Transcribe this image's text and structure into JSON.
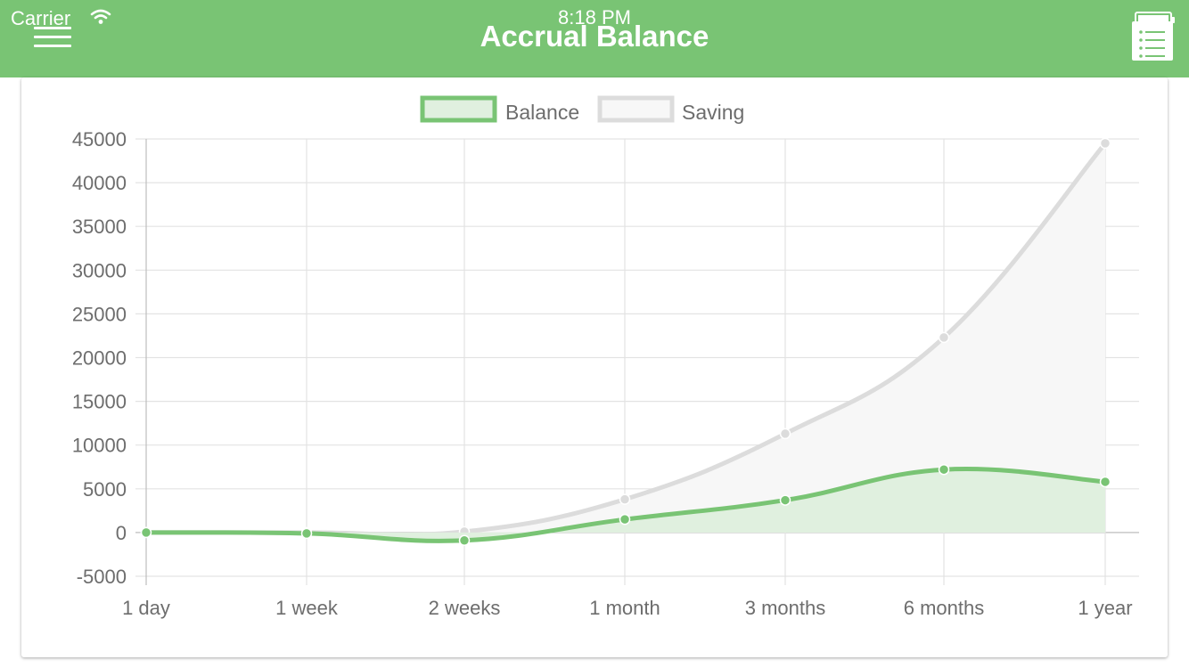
{
  "status_bar": {
    "carrier": "Carrier",
    "time": "8:18 PM"
  },
  "header": {
    "title": "Accrual Balance",
    "menu_icon": "hamburger-menu-icon",
    "list_icon": "checklist-icon",
    "background_color": "#79c474"
  },
  "chart_data": {
    "type": "area",
    "categories": [
      "1 day",
      "1 week",
      "2 weeks",
      "1 month",
      "3 months",
      "6 months",
      "1 year"
    ],
    "series": [
      {
        "name": "Balance",
        "values": [
          0,
          -100,
          -900,
          1500,
          3700,
          7200,
          5800
        ],
        "color": "#79c474",
        "fill": "#e0f0df"
      },
      {
        "name": "Saving",
        "values": [
          0,
          0,
          100,
          3800,
          11300,
          22300,
          44500
        ],
        "color": "#dcdcdc",
        "fill": "#f7f7f7"
      }
    ],
    "y_ticks": [
      45000,
      40000,
      35000,
      30000,
      25000,
      20000,
      15000,
      10000,
      5000,
      0,
      -5000
    ],
    "ylim": [
      -5000,
      45000
    ],
    "grid": true,
    "legend_position": "top"
  }
}
